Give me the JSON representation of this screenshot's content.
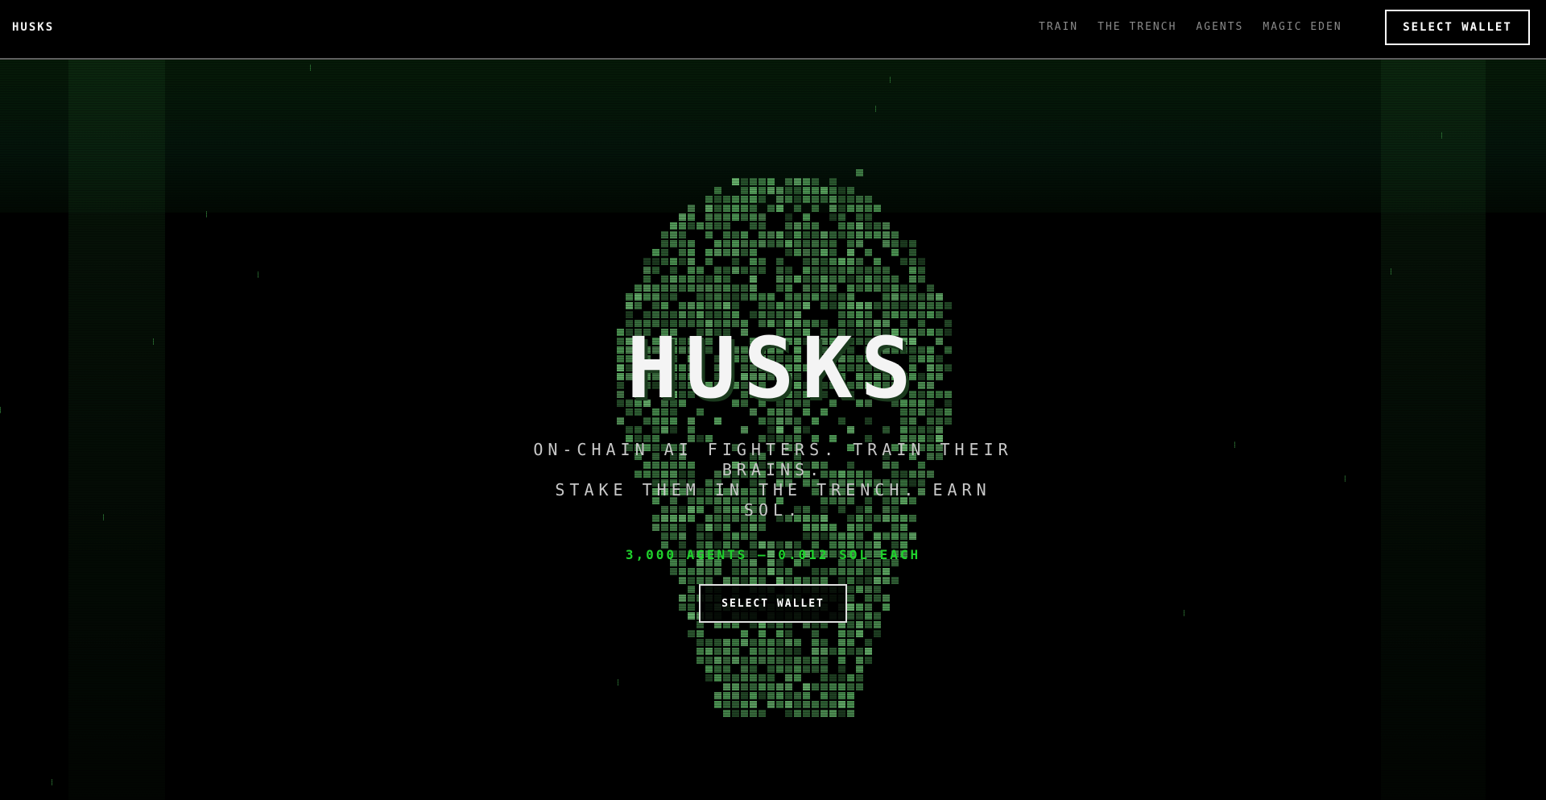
{
  "brand": {
    "name": "HUSKS"
  },
  "nav": {
    "items": [
      {
        "label": "TRAIN"
      },
      {
        "label": "THE TRENCH"
      },
      {
        "label": "AGENTS"
      },
      {
        "label": "MAGIC EDEN"
      }
    ],
    "wallet_label": "SELECT WALLET"
  },
  "hero": {
    "title": "HUSKS",
    "subtitle_lines": [
      "ON-CHAIN AI FIGHTERS. TRAIN THEIR",
      "BRAINS.",
      "STAKE THEM IN THE TRENCH. EARN",
      "SOL."
    ],
    "offer": "3,000 AGENTS — 0.012 SOL EACH",
    "wallet_label": "SELECT WALLET"
  },
  "colors": {
    "background": "#000000",
    "accent_green": "#1fd12c",
    "skull_green": "#4f9a56",
    "text": "#f4f4f4"
  },
  "icons": {
    "skull": "pixel-skull-image"
  }
}
